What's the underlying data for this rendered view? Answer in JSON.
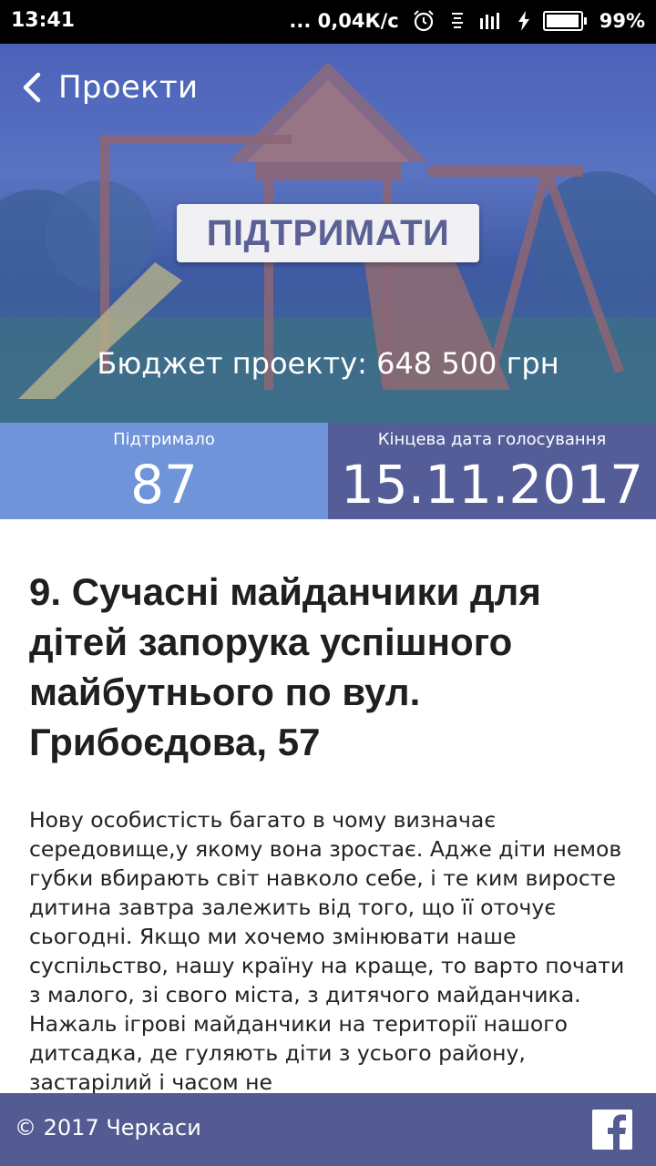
{
  "status_bar": {
    "time": "13:41",
    "network_speed": "... 0,04К/с",
    "battery_percent": "99%",
    "battery_level": 0.99,
    "icons": [
      "alarm-icon",
      "vibrate-icon",
      "signal-icon",
      "charging-icon",
      "battery-icon"
    ]
  },
  "header": {
    "back_label": "Проекти",
    "support_button": "ПІДТРИМАТИ",
    "budget_text": "Бюджет проекту: 648 500 грн"
  },
  "stats": {
    "supported_label": "Підтримало",
    "supported_value": "87",
    "deadline_label": "Кінцева дата голосування",
    "deadline_value": "15.11.2017"
  },
  "project": {
    "title": "9. Сучасні майданчики для дітей запорука успішного майбутнього по вул. Грибоєдова, 57",
    "description": "Нову особистість багато в чому визначає середовище,у якому вона зростає. Адже діти немов губки вбирають світ навколо себе, і те ким виросте дитина завтра залежить від того, що її оточує сьогодні. Якщо ми хочемо змінювати наше суспільство, нашу країну на краще, то варто почати з малого, зі свого міста, з дитячого майданчика. Нажаль ігрові майданчики на території нашого дитсадка, де гуляють діти з усього району, застарілий і часом не"
  },
  "footer": {
    "copyright": "© 2017 Черкаси",
    "social_icon": "facebook-icon"
  },
  "colors": {
    "accent_light": "#6f94d9",
    "accent_dark": "#555d98",
    "footer": "#545a92",
    "button_text": "#5b6196"
  }
}
